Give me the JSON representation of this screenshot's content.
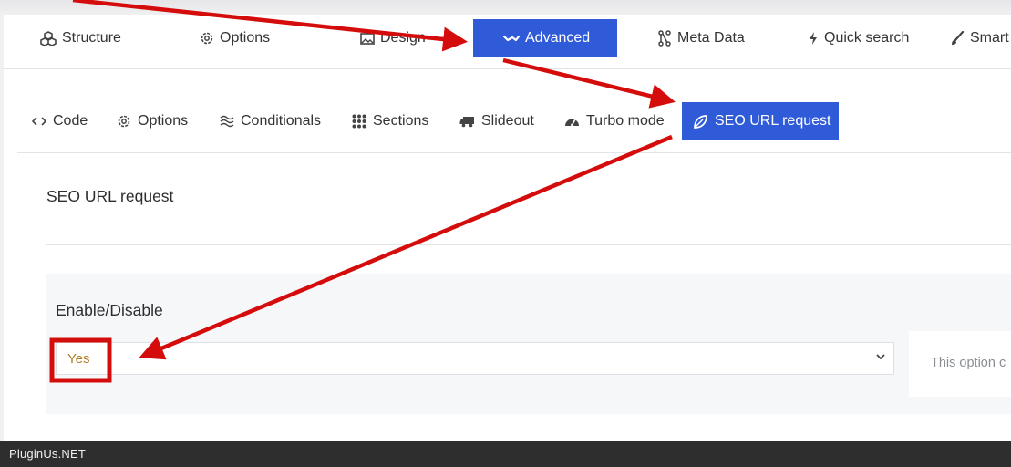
{
  "main_tabs": [
    {
      "label": "Structure",
      "icon": "cubes-icon"
    },
    {
      "label": "Options",
      "icon": "gear-icon"
    },
    {
      "label": "Design",
      "icon": "image-icon"
    },
    {
      "label": "Advanced",
      "icon": "wave-icon",
      "active": true
    },
    {
      "label": "Meta Data",
      "icon": "nodes-icon"
    },
    {
      "label": "Quick search",
      "icon": "bolt-icon"
    },
    {
      "label": "Smart",
      "icon": "brush-icon"
    }
  ],
  "sub_tabs": [
    {
      "label": "Code",
      "icon": "code-icon"
    },
    {
      "label": "Options",
      "icon": "gear-icon"
    },
    {
      "label": "Conditionals",
      "icon": "approx-icon"
    },
    {
      "label": "Sections",
      "icon": "grid-dots-icon"
    },
    {
      "label": "Slideout",
      "icon": "truck-icon"
    },
    {
      "label": "Turbo mode",
      "icon": "gauge-icon"
    },
    {
      "label": "SEO URL request",
      "icon": "leaf-icon",
      "active": true
    }
  ],
  "section": {
    "title": "SEO URL request"
  },
  "option": {
    "label": "Enable/Disable",
    "select_value": "Yes",
    "help_text": "This option c"
  },
  "footer": {
    "brand": "PluginUs.NET"
  },
  "colors": {
    "accent": "#2f5ad8",
    "annotation_red": "#d40c0c",
    "select_value": "#b07d2b"
  }
}
